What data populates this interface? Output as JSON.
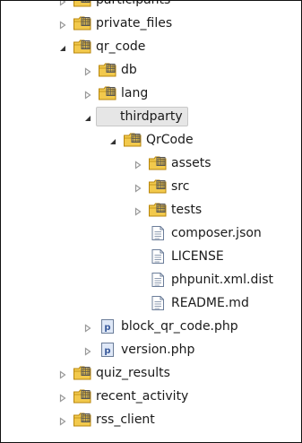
{
  "tree": {
    "items": [
      {
        "label": "participants",
        "type": "folder",
        "state": "collapsed",
        "level": 1
      },
      {
        "label": "private_files",
        "type": "folder",
        "state": "collapsed",
        "level": 1
      },
      {
        "label": "qr_code",
        "type": "folder",
        "state": "expanded",
        "level": 1
      },
      {
        "label": "db",
        "type": "folder",
        "state": "collapsed",
        "level": 2
      },
      {
        "label": "lang",
        "type": "folder",
        "state": "collapsed",
        "level": 2
      },
      {
        "label": "thirdparty",
        "type": "folder",
        "state": "expanded",
        "level": 2,
        "selected": true
      },
      {
        "label": "QrCode",
        "type": "folder",
        "state": "expanded",
        "level": 3
      },
      {
        "label": "assets",
        "type": "folder",
        "state": "collapsed",
        "level": 4
      },
      {
        "label": "src",
        "type": "folder",
        "state": "collapsed",
        "level": 4
      },
      {
        "label": "tests",
        "type": "folder",
        "state": "collapsed",
        "level": 4
      },
      {
        "label": "composer.json",
        "type": "file",
        "state": "none",
        "level": 4
      },
      {
        "label": "LICENSE",
        "type": "file",
        "state": "none",
        "level": 4
      },
      {
        "label": "phpunit.xml.dist",
        "type": "file",
        "state": "none",
        "level": 4
      },
      {
        "label": "README.md",
        "type": "file",
        "state": "none",
        "level": 4
      },
      {
        "label": "block_qr_code.php",
        "type": "php",
        "state": "collapsed",
        "level": 2
      },
      {
        "label": "version.php",
        "type": "php",
        "state": "collapsed",
        "level": 2
      },
      {
        "label": "quiz_results",
        "type": "folder",
        "state": "collapsed",
        "level": 1
      },
      {
        "label": "recent_activity",
        "type": "folder",
        "state": "collapsed",
        "level": 1
      },
      {
        "label": "rss_client",
        "type": "folder",
        "state": "collapsed",
        "level": 1
      }
    ]
  },
  "colors": {
    "folder_fill": "#f2c94c",
    "folder_stroke": "#b8860b",
    "file_stroke": "#6b7d99",
    "php_fill": "#dfe8f7",
    "php_text": "#3a5a9b",
    "arrow_expanded": "#333333",
    "arrow_collapsed": "#999999",
    "selection": "#e6e6e6"
  }
}
